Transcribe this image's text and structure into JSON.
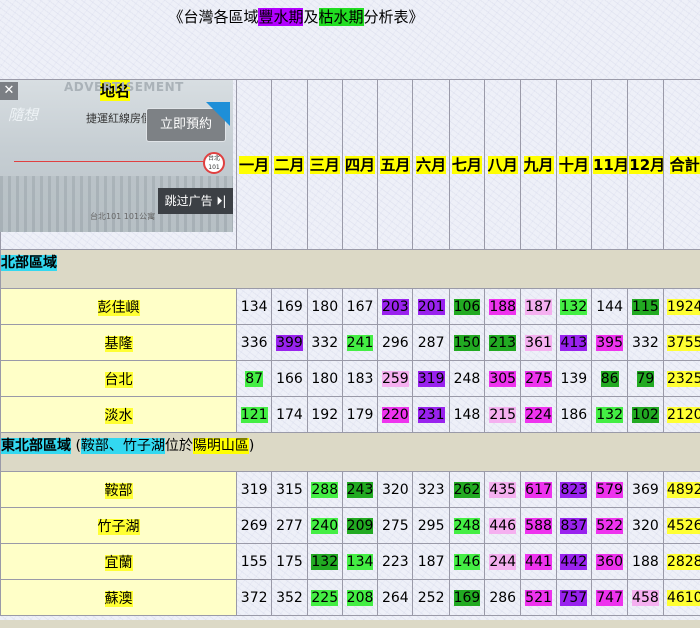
{
  "title": {
    "prefix": "《台灣各區域",
    "wet": "豐水期",
    "mid": "及",
    "dry": "枯水期",
    "suffix": "分析表》"
  },
  "header": {
    "place_label": "地名",
    "months": [
      "一月",
      "二月",
      "三月",
      "四月",
      "五月",
      "六月",
      "七月",
      "八月",
      "九月",
      "十月",
      "11月",
      "12月"
    ],
    "total_label": "合計"
  },
  "regions": [
    {
      "name": "北部區域",
      "stations": [
        {
          "name": "彭佳嶼",
          "values": [
            134,
            169,
            180,
            167,
            203,
            201,
            106,
            188,
            187,
            132,
            144,
            115
          ],
          "total": 1924
        },
        {
          "name": "基隆",
          "values": [
            336,
            399,
            332,
            241,
            296,
            287,
            150,
            213,
            361,
            413,
            395,
            332
          ],
          "total": 3755
        },
        {
          "name": "台北",
          "values": [
            87,
            166,
            180,
            183,
            259,
            319,
            248,
            305,
            275,
            139,
            86,
            79
          ],
          "total": 2325
        },
        {
          "name": "淡水",
          "values": [
            121,
            174,
            192,
            179,
            220,
            231,
            148,
            215,
            224,
            186,
            132,
            102
          ],
          "total": 2120
        }
      ]
    },
    {
      "name": "東北部區域",
      "note": {
        "open": " (",
        "cyan": "鞍部、竹子湖",
        "mid": "位於",
        "yellow": "陽明山區",
        "close": ")"
      },
      "stations": [
        {
          "name": "鞍部",
          "values": [
            319,
            315,
            288,
            243,
            320,
            323,
            262,
            435,
            617,
            823,
            579,
            369
          ],
          "total": 4892
        },
        {
          "name": "竹子湖",
          "values": [
            269,
            277,
            240,
            209,
            275,
            295,
            248,
            446,
            588,
            837,
            522,
            320
          ],
          "total": 4526
        },
        {
          "name": "宜蘭",
          "values": [
            155,
            175,
            132,
            134,
            223,
            187,
            146,
            244,
            441,
            442,
            360,
            188
          ],
          "total": 2828
        },
        {
          "name": "蘇澳",
          "values": [
            372,
            352,
            225,
            208,
            264,
            252,
            169,
            286,
            521,
            757,
            747,
            458
          ],
          "total": 4610
        }
      ]
    }
  ],
  "cell_colors": [
    [
      "",
      "",
      "",
      "",
      "p",
      "p",
      "dg",
      "m",
      "lp",
      "lg",
      "",
      "dg"
    ],
    [
      "",
      "p",
      "",
      "lg",
      "",
      "",
      "dg",
      "dg",
      "lp",
      "p",
      "m",
      ""
    ],
    [
      "lg",
      "",
      "",
      "",
      "lp",
      "p",
      "",
      "m",
      "m",
      "",
      "dg",
      "dg"
    ],
    [
      "lg",
      "",
      "",
      "",
      "m",
      "p",
      "",
      "lp",
      "m",
      "",
      "lg",
      "dg"
    ],
    [
      "",
      "",
      "lg",
      "dg",
      "",
      "",
      "dg",
      "lp",
      "m",
      "p",
      "m",
      ""
    ],
    [
      "",
      "",
      "lg",
      "dg",
      "",
      "",
      "lg",
      "lp",
      "m",
      "p",
      "m",
      ""
    ],
    [
      "",
      "",
      "dg",
      "lg",
      "",
      "",
      "lg",
      "lp",
      "m",
      "p",
      "m",
      ""
    ],
    [
      "",
      "",
      "lg",
      "lg",
      "",
      "",
      "dg",
      "",
      "m",
      "p",
      "m",
      "lp"
    ]
  ],
  "color_map": {
    "lp": "#f5b0f0",
    "m": "#ee33ee",
    "p": "#9922ee",
    "lg": "#44ee44",
    "dg": "#22aa22"
  },
  "ad": {
    "label": "ADVERTISEMENT",
    "close": "✕",
    "logo": "隨想",
    "tagline": "捷運紅線房價",
    "book_button": "立即預約",
    "badge": "台北 101",
    "skip_button": "跳过广告 ⏵|",
    "footer": "台北101 101公寓"
  }
}
